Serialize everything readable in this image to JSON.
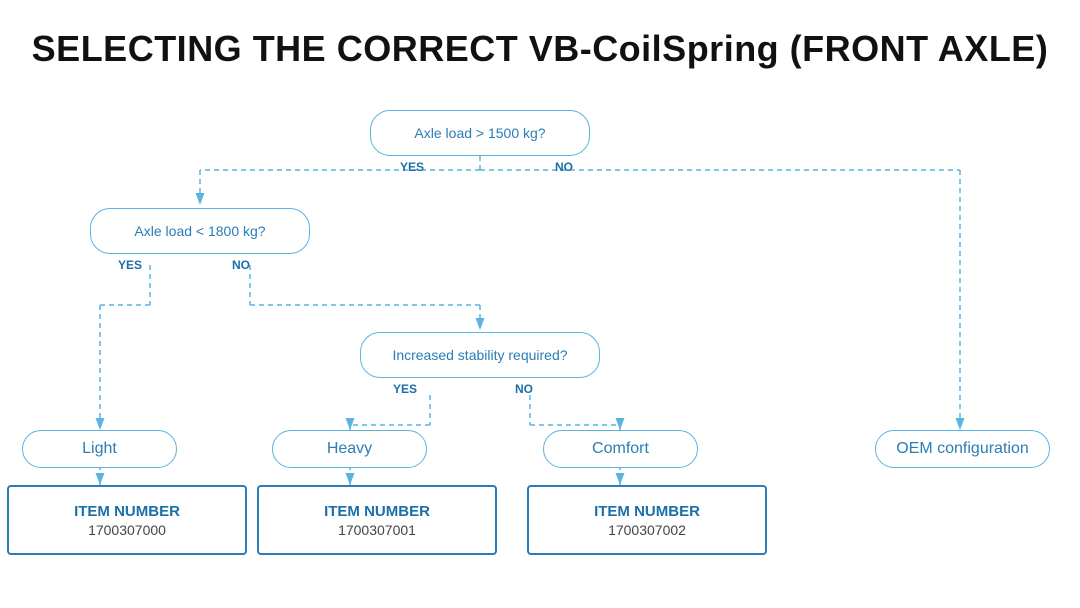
{
  "page": {
    "title": "SELECTING THE CORRECT VB-CoilSpring (FRONT AXLE)"
  },
  "decisions": {
    "q1": {
      "label": "Axle load > 1500 kg?",
      "yes": "YES",
      "no": "NO"
    },
    "q2": {
      "label": "Axle load < 1800 kg?",
      "yes": "YES",
      "no": "NO"
    },
    "q3": {
      "label": "Increased stability required?",
      "yes": "YES",
      "no": "NO"
    }
  },
  "results": {
    "light": "Light",
    "heavy": "Heavy",
    "comfort": "Comfort",
    "oem": "OEM configuration"
  },
  "items": {
    "item1": {
      "label": "ITEM NUMBER",
      "number": "1700307000"
    },
    "item2": {
      "label": "ITEM NUMBER",
      "number": "1700307001"
    },
    "item3": {
      "label": "ITEM NUMBER",
      "number": "1700307002"
    }
  }
}
